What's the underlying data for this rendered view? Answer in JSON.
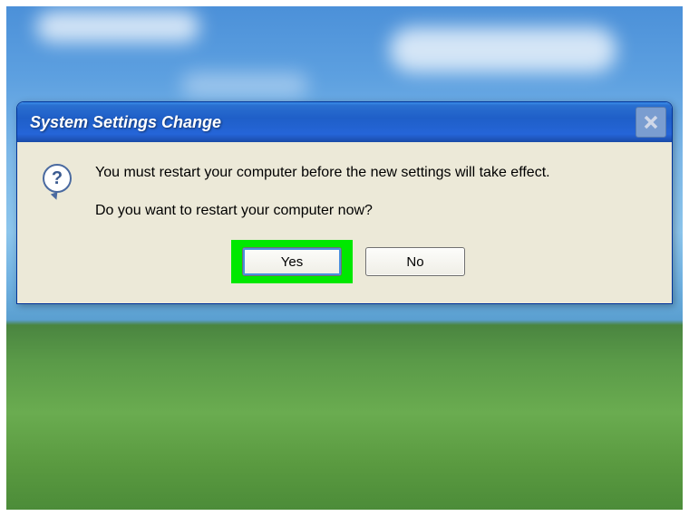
{
  "dialog": {
    "title": "System Settings Change",
    "message_line1": "You must restart your computer before the new settings will take effect.",
    "message_line2": "Do you want to restart your computer now?",
    "icon": "question-icon",
    "buttons": {
      "yes": "Yes",
      "no": "No"
    },
    "highlighted_button": "yes"
  },
  "colors": {
    "highlight": "#00e800",
    "titlebar_start": "#3a8de8",
    "titlebar_end": "#1a4aa8",
    "dialog_bg": "#ece9d8"
  }
}
